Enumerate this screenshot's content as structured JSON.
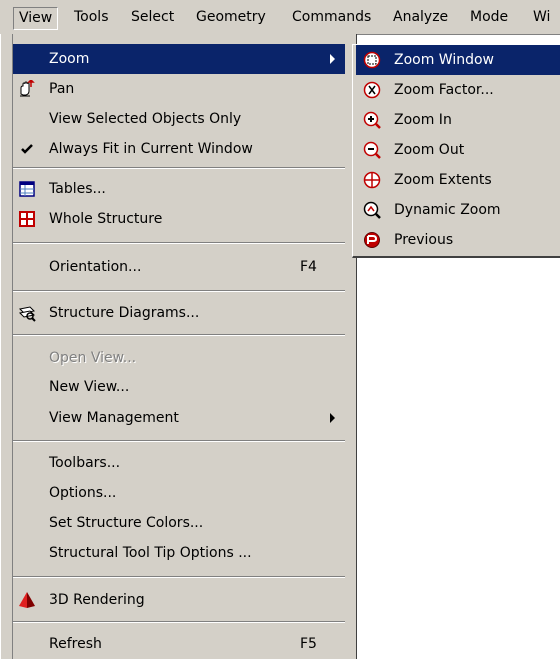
{
  "menubar": {
    "items": [
      "View",
      "Tools",
      "Select",
      "Geometry",
      "Commands",
      "Analyze",
      "Mode",
      "Wi"
    ]
  },
  "view_menu": {
    "zoom": "Zoom",
    "pan": "Pan",
    "view_selected": "View Selected Objects Only",
    "always_fit": "Always Fit in Current Window",
    "always_fit_checked": true,
    "tables": "Tables...",
    "whole_structure": "Whole Structure",
    "orientation": "Orientation...",
    "orientation_shortcut": "F4",
    "structure_diagrams": "Structure Diagrams...",
    "open_view": "Open View...",
    "new_view": "New View...",
    "view_management": "View Management",
    "toolbars": "Toolbars...",
    "options": "Options...",
    "set_structure_colors": "Set Structure Colors...",
    "structural_tool_tip": "Structural Tool Tip Options ...",
    "rendering_3d": "3D Rendering",
    "refresh": "Refresh",
    "refresh_shortcut": "F5"
  },
  "zoom_submenu": {
    "items": [
      "Zoom Window",
      "Zoom Factor...",
      "Zoom In",
      "Zoom Out",
      "Zoom Extents",
      "Dynamic Zoom",
      "Previous"
    ]
  },
  "colors": {
    "menu_bg": "#d4d0c8",
    "highlight": "#0a246a",
    "disabled_text": "#808080"
  }
}
